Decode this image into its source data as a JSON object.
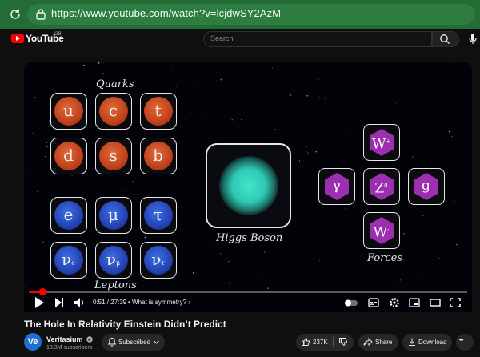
{
  "browser": {
    "url": "https://www.youtube.com/watch?v=lcjdwSY2AzM"
  },
  "header": {
    "logo_text": "YouTube",
    "region": "GB",
    "search_placeholder": "Search"
  },
  "video": {
    "quarks_label": "Quarks",
    "leptons_label": "Leptons",
    "higgs_label": "Higgs Boson",
    "forces_label": "Forces",
    "quarks": [
      "u",
      "c",
      "t",
      "d",
      "s",
      "b"
    ],
    "leptons": [
      "e",
      "μ",
      "τ"
    ],
    "neutrinos": [
      {
        "base": "ν",
        "sub": "e"
      },
      {
        "base": "ν",
        "sub": "μ"
      },
      {
        "base": "ν",
        "sub": "τ"
      }
    ],
    "bosons": {
      "w_plus": {
        "base": "W",
        "sup": "+"
      },
      "photon": {
        "base": "γ"
      },
      "z": {
        "base": "Z",
        "sup": "0"
      },
      "gluon": {
        "base": "g"
      },
      "w_minus": {
        "base": "W",
        "sup": "-"
      }
    },
    "colors": {
      "quark": "#c4441d",
      "lepton": "#2546b9",
      "higgs": "#2fc9b3",
      "boson": "#9b2fb0",
      "progress": "#ff0000"
    }
  },
  "player": {
    "progress": 0.031,
    "time": "0:51 / 27:39",
    "chapter": "• What is symmetry?",
    "chapter_arrow": "›"
  },
  "meta": {
    "title": "The Hole In Relativity Einstein Didn’t Predict",
    "channel": "Veritasium",
    "avatar_text": "Ve",
    "subscribers": "18.3M subscribers",
    "subscribe_label": "Subscribed",
    "likes": "237K",
    "share_label": "Share",
    "download_label": "Download",
    "more": "•••"
  }
}
